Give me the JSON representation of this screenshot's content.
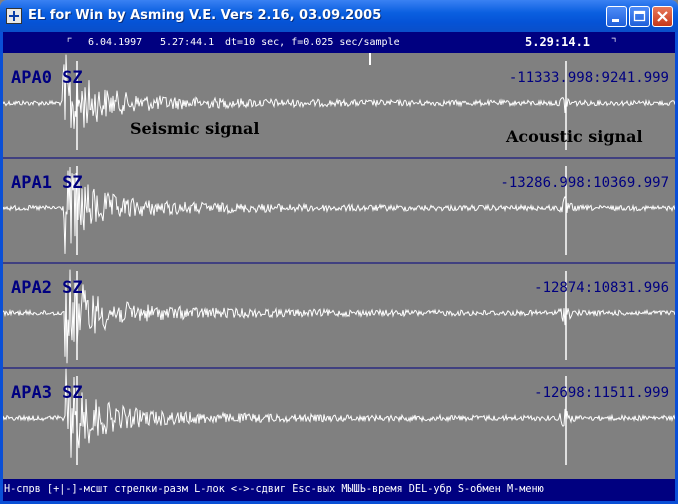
{
  "window": {
    "title": "EL for Win by Asming V.E. Vers 2.16, 03.09.2005",
    "controls": [
      "minimize",
      "maximize",
      "close"
    ]
  },
  "header": {
    "date": "6.04.1997",
    "start_time": "5.27:44.1",
    "params": "dt=10 sec, f=0.025 sec/sample",
    "cursor_time": "5.29:14.1"
  },
  "channels": [
    {
      "name": "APA0 SZ",
      "range": "-11333.998:9241.999"
    },
    {
      "name": "APA1 SZ",
      "range": "-13286.998:10369.997"
    },
    {
      "name": "APA2 SZ",
      "range": "-12874:10831.996"
    },
    {
      "name": "APA3 SZ",
      "range": "-12698:11511.999"
    }
  ],
  "annotations": {
    "seismic": "Seismic signal",
    "acoustic": "Acoustic signal"
  },
  "status_line": "H-спрв [+|-]-мсшт стрелки-разм L-лок <->-сдвиг Esc-вых МЫШЬ-время DEL-убр S-обмен M-меню",
  "colors": {
    "background": "#808080",
    "bar": "#000080",
    "trace": "#ffffff",
    "separator": "#000080"
  }
}
